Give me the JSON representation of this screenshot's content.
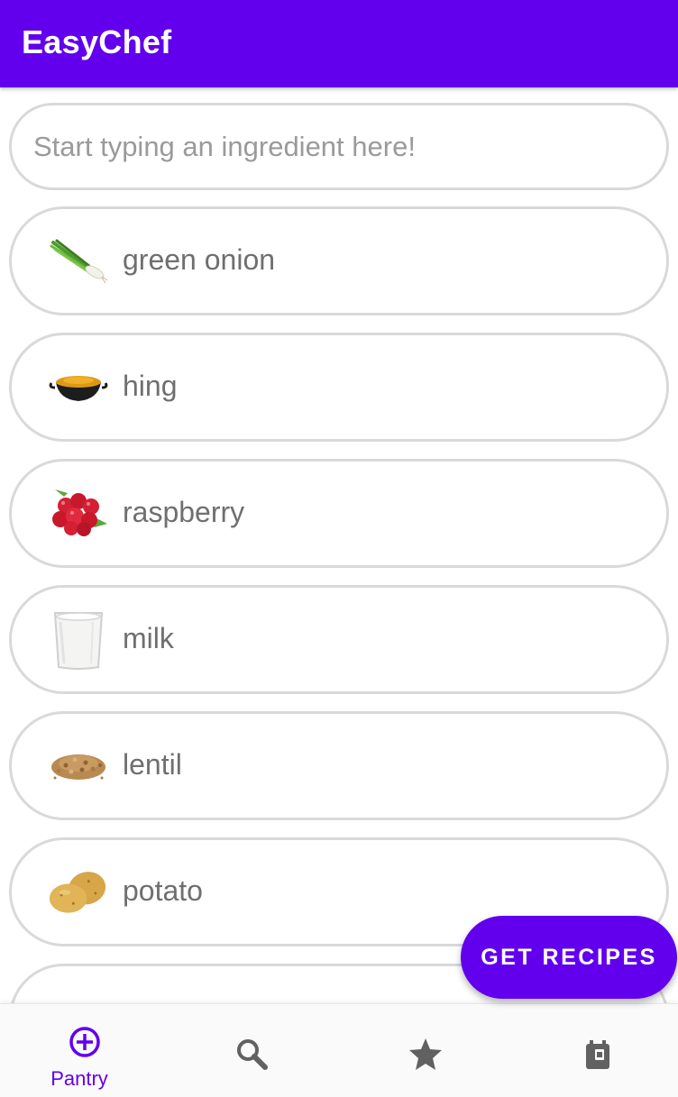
{
  "app": {
    "title": "EasyChef"
  },
  "search": {
    "placeholder": "Start typing an ingredient here!"
  },
  "ingredients": [
    {
      "label": "green onion",
      "icon": "green-onion-icon"
    },
    {
      "label": "hing",
      "icon": "hing-icon"
    },
    {
      "label": "raspberry",
      "icon": "raspberry-icon"
    },
    {
      "label": "milk",
      "icon": "milk-icon"
    },
    {
      "label": "lentil",
      "icon": "lentil-icon"
    },
    {
      "label": "potato",
      "icon": "potato-icon"
    }
  ],
  "fab": {
    "label": "GET RECIPES"
  },
  "bottom_nav": {
    "items": [
      {
        "label": "Pantry",
        "icon": "add-circle-icon",
        "selected": true
      },
      {
        "label": "",
        "icon": "search-icon",
        "selected": false
      },
      {
        "label": "",
        "icon": "star-icon",
        "selected": false
      },
      {
        "label": "",
        "icon": "planner-icon",
        "selected": false
      }
    ]
  },
  "colors": {
    "primary": "#6200ee",
    "item_border": "#d9d9d9",
    "label_text": "#6f6f6f",
    "nav_inactive": "#616161"
  }
}
